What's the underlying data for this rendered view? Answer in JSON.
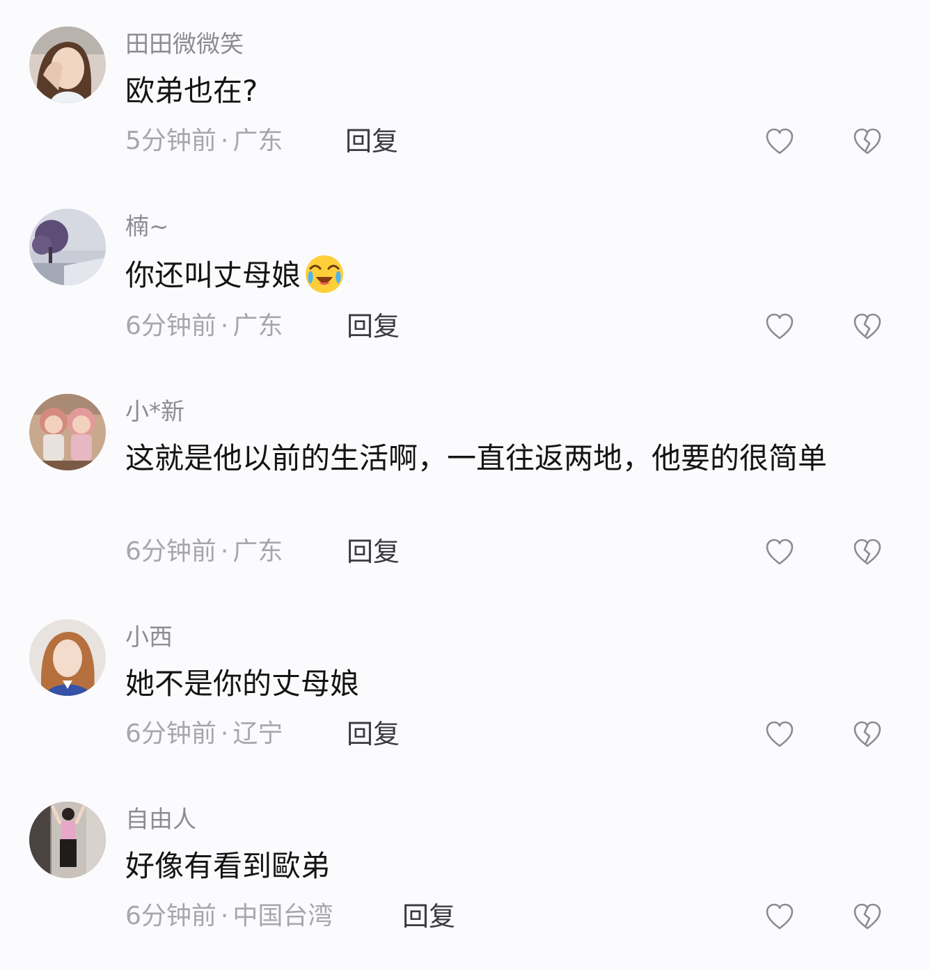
{
  "comments": [
    {
      "username": "田田微微笑",
      "text": "欧弟也在?",
      "time": "5分钟前",
      "separator": "·",
      "location": "广东",
      "reply_label": "回复",
      "avatar_icon": "avatar-girl-photo"
    },
    {
      "username": "楠~",
      "text": "你还叫丈母娘",
      "emoji": "laugh-cry-emoji-icon",
      "time": "6分钟前",
      "separator": "·",
      "location": "广东",
      "reply_label": "回复",
      "avatar_icon": "avatar-tree-landscape"
    },
    {
      "username": "小*新",
      "text": "这就是他以前的生活啊，一直往返两地，他要的很简单",
      "time": "6分钟前",
      "separator": "·",
      "location": "广东",
      "reply_label": "回复",
      "avatar_icon": "avatar-cartoon-dolls"
    },
    {
      "username": "小西",
      "text": "她不是你的丈母娘",
      "time": "6分钟前",
      "separator": "·",
      "location": "辽宁",
      "reply_label": "回复",
      "avatar_icon": "avatar-woman-portrait"
    },
    {
      "username": "自由人",
      "text": "好像有看到歐弟",
      "time": "6分钟前",
      "separator": "·",
      "location": "中国台湾",
      "reply_label": "回复",
      "avatar_icon": "avatar-person-mirror"
    }
  ],
  "icons": {
    "like": "heart-outline-icon",
    "dislike": "broken-heart-outline-icon"
  },
  "colors": {
    "background": "#fbfbfd",
    "username": "#8c8c95",
    "text": "#141414",
    "meta": "#a6a6ad",
    "reply": "#3a3a40",
    "icon": "#8a8a92"
  }
}
